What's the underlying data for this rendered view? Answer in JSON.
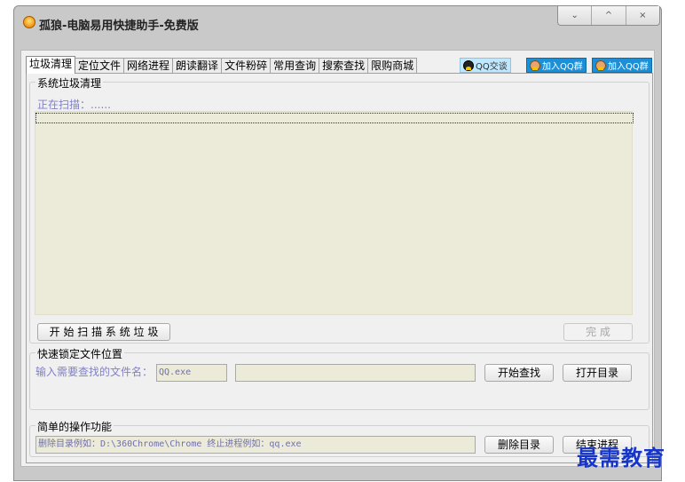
{
  "window": {
    "title": "孤狼-电脑易用快捷助手-免费版",
    "caption": {
      "minimize": "⌄",
      "maximize": "^",
      "close": "×"
    }
  },
  "tabs": [
    "垃圾清理",
    "定位文件",
    "网络进程",
    "朗读翻译",
    "文件粉碎",
    "常用查询",
    "搜索查找",
    "限购商城"
  ],
  "qq_buttons": {
    "chat": "QQ交谈",
    "group1": "加入QQ群",
    "group2": "加入QQ群"
  },
  "junk": {
    "title": "系统垃圾清理",
    "scanning": "正在扫描：......",
    "start_button": "开 始 扫 描 系 统 垃 圾",
    "done_button": "完  成"
  },
  "locate": {
    "title": "快速锁定文件位置",
    "label": "输入需要查找的文件名：",
    "filename_value": "QQ.exe",
    "result_value": "",
    "search_button": "开始查找",
    "open_dir_button": "打开目录"
  },
  "ops": {
    "title": "简单的操作功能",
    "hint_value": "删除目录例如：D:\\360Chrome\\Chrome 终止进程例如：qq.exe",
    "delete_dir_button": "删除目录",
    "kill_process_button": "结束进程"
  },
  "watermark": "最需教育"
}
